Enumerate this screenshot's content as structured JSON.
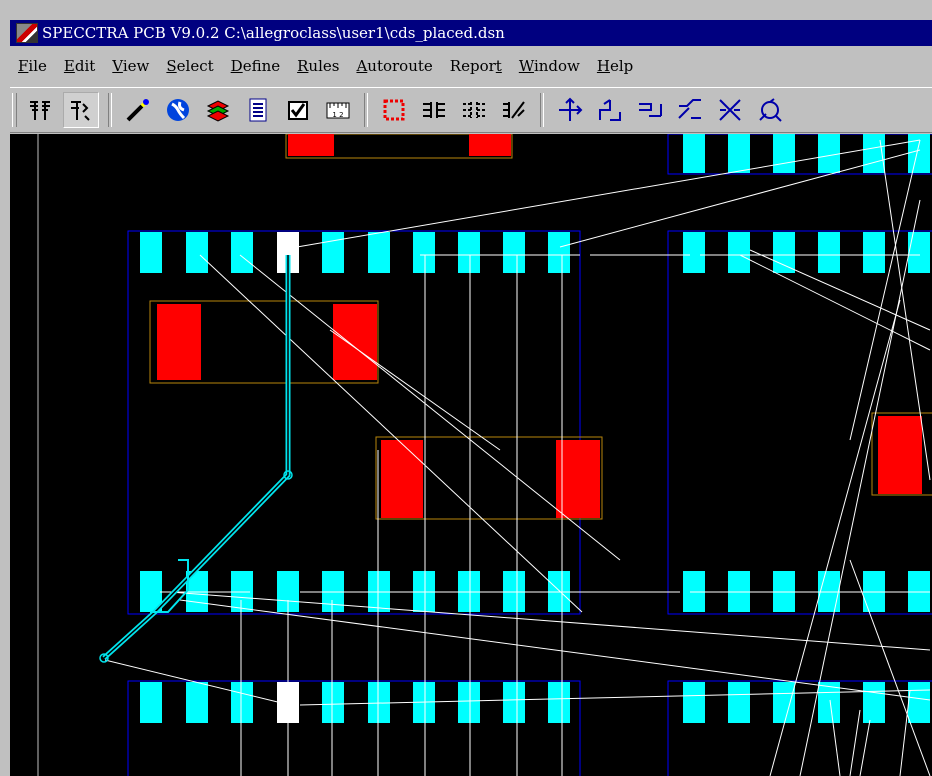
{
  "window": {
    "title": "SPECCTRA PCB V9.0.2 C:\\allegroclass\\user1\\cds_placed.dsn"
  },
  "menu": [
    {
      "mnemonic": "F",
      "rest": "ile"
    },
    {
      "mnemonic": "E",
      "rest": "dit"
    },
    {
      "mnemonic": "V",
      "rest": "iew"
    },
    {
      "mnemonic": "S",
      "rest": "elect"
    },
    {
      "mnemonic": "D",
      "rest": "efine"
    },
    {
      "mnemonic": "R",
      "rest": "ules"
    },
    {
      "mnemonic": "A",
      "rest": "utoroute"
    },
    {
      "pre": "Repor",
      "mnemonic": "t",
      "rest": ""
    },
    {
      "mnemonic": "W",
      "rest": "indow"
    },
    {
      "mnemonic": "H",
      "rest": "elp"
    }
  ],
  "toolbar": {
    "buttons": [
      "place-mode-icon",
      "route-mode-icon",
      "wand-icon",
      "globe-icon",
      "layers-icon",
      "report-icon",
      "checkbox-icon",
      "ruler-icon",
      "select-area-icon",
      "fanout-icon",
      "fanout-dashed-icon",
      "route-diagonal-icon",
      "move-icon",
      "push-route-icon",
      "shove-icon",
      "miter-icon",
      "cut-icon",
      "rotate-icon"
    ],
    "ruler_text": "1 2"
  },
  "colors": {
    "background": "#000000",
    "board_outline": "#0000ff",
    "pad": "#00ffff",
    "selected_pad": "#ffffff",
    "component_body": "#ff0000",
    "component_outline": "#b8860b",
    "ratsnest": "#ffffff",
    "trace": "#00e5ee"
  }
}
